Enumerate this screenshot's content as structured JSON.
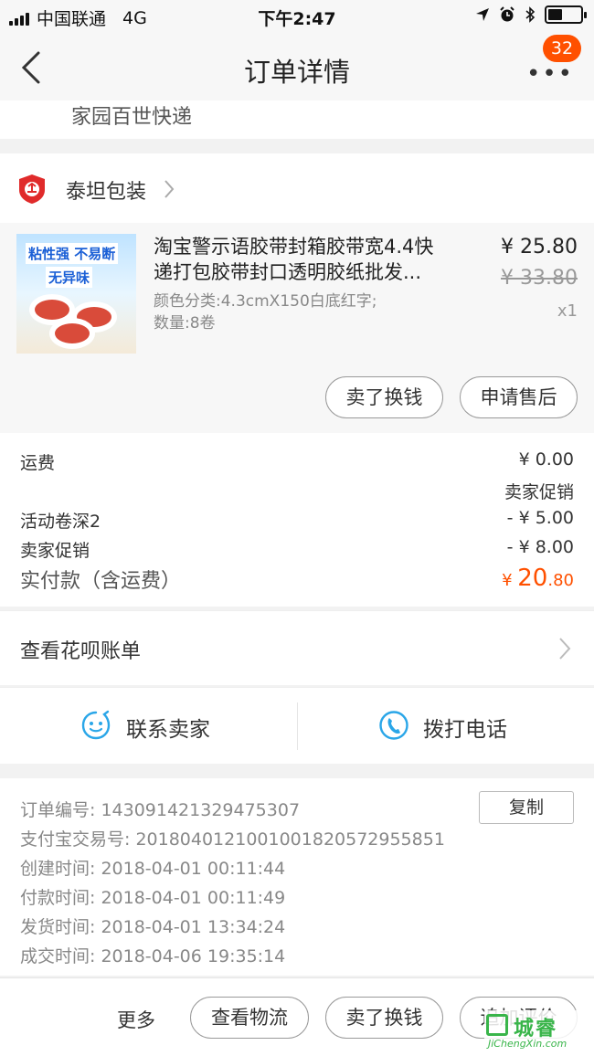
{
  "status_bar": {
    "carrier": "中国联通",
    "network": "4G",
    "time": "下午2:47"
  },
  "nav": {
    "title": "订单详情",
    "more": "•••",
    "badge": "32"
  },
  "logistics": {
    "text": "家园百世快递"
  },
  "shop": {
    "name": "泰坦包装"
  },
  "product": {
    "title_line1": "淘宝警示语胶带封箱胶带宽4.4快",
    "title_line2": "递打包胶带封口透明胶纸批发...",
    "spec_line1": "颜色分类:4.3cmX150白底红字;",
    "spec_line2": "数量:8卷",
    "price": "¥ 25.80",
    "original_price": "¥ 33.80",
    "quantity": "x1",
    "thumb_text1": "粘性强 不易断",
    "thumb_text2": "无异味",
    "sell_label": "卖了换钱",
    "aftersale_label": "申请售后"
  },
  "fees": {
    "shipping_label": "运费",
    "shipping_value": "¥ 0.00",
    "seller_promo_tag": "卖家促销",
    "coupon_label": "活动卷深2",
    "coupon_value": "- ¥ 5.00",
    "promo_label": "卖家促销",
    "promo_value": "- ¥ 8.00",
    "total_label": "实付款（含运费）",
    "total_currency": "¥ ",
    "total_int": "20",
    "total_dec": ".80"
  },
  "huabei": {
    "label": "查看花呗账单"
  },
  "contact": {
    "seller_label": "联系卖家",
    "phone_label": "拨打电话"
  },
  "order_info": {
    "order_no": "订单编号:   143091421329475307",
    "alipay_no": "支付宝交易号:   2018040121001001820572955851",
    "created": "创建时间:   2018-04-01 00:11:44",
    "paid": "付款时间:   2018-04-01 00:11:49",
    "shipped": "发货时间:   2018-04-01 13:34:24",
    "completed": "成交时间:   2018-04-06 19:35:14",
    "copy_label": "复制"
  },
  "bottom_bar": {
    "more_label": "更多",
    "logistics_label": "查看物流",
    "sell_label": "卖了换钱",
    "review_label": "追加评价"
  },
  "watermark": {
    "text": "城睿",
    "sub": "JiChengXin.com"
  },
  "colors": {
    "accent": "#ff5000",
    "divider": "#f2f2f2",
    "icon_blue": "#2aa6e8"
  }
}
